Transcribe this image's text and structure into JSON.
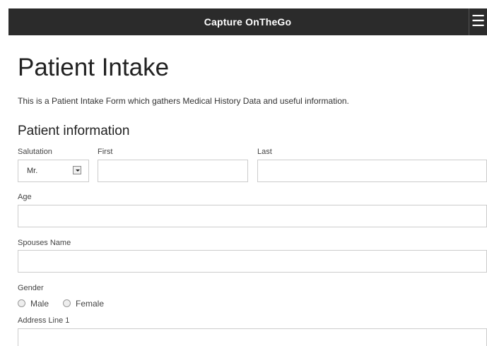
{
  "header": {
    "title": "Capture OnTheGo",
    "menu_icon": "hamburger-menu-icon"
  },
  "page": {
    "title": "Patient Intake",
    "description": "This is a Patient Intake Form which gathers Medical History Data and useful information."
  },
  "section": {
    "title": "Patient information"
  },
  "form": {
    "salutation": {
      "label": "Salutation",
      "value": "Mr."
    },
    "first": {
      "label": "First",
      "value": ""
    },
    "last": {
      "label": "Last",
      "value": ""
    },
    "age": {
      "label": "Age",
      "value": ""
    },
    "spouses_name": {
      "label": "Spouses Name",
      "value": ""
    },
    "gender": {
      "label": "Gender",
      "options": [
        "Male",
        "Female"
      ],
      "selected": null
    },
    "address_line_1": {
      "label": "Address Line 1",
      "value": ""
    }
  }
}
